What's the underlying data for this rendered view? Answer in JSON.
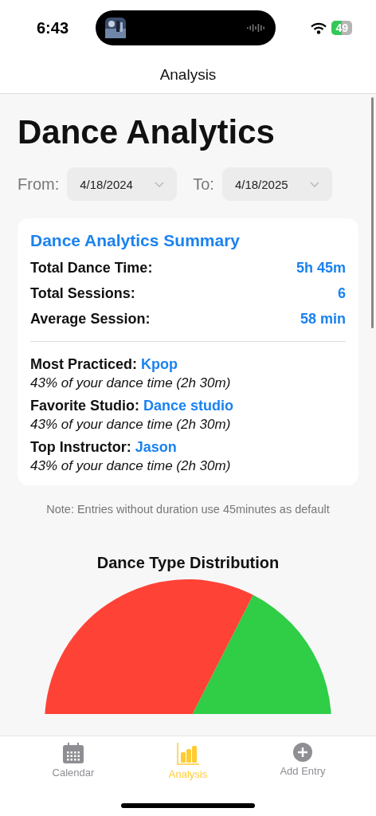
{
  "status_bar": {
    "time": "6:43",
    "battery": "49"
  },
  "nav": {
    "title": "Analysis"
  },
  "heading": "Dance Analytics",
  "range": {
    "from_label": "From:",
    "from": "4/18/2024",
    "to_label": "To:",
    "to": "4/18/2025"
  },
  "summary": {
    "title": "Dance Analytics Summary",
    "stats": [
      {
        "label": "Total Dance Time:",
        "value": "5h 45m"
      },
      {
        "label": "Total Sessions:",
        "value": "6"
      },
      {
        "label": "Average Session:",
        "value": "58 min"
      }
    ],
    "highlights": [
      {
        "label": "Most Practiced:",
        "value": "Kpop",
        "detail": "43% of your dance time (2h 30m)"
      },
      {
        "label": "Favorite Studio:",
        "value": "Dance studio",
        "detail": "43% of your dance time (2h 30m)"
      },
      {
        "label": "Top Instructor:",
        "value": "Jason",
        "detail": "43% of your dance time (2h 30m)"
      }
    ]
  },
  "note": "Note: Entries without duration use 45minutes as default",
  "chart": {
    "title": "Dance Type Distribution"
  },
  "tabs": [
    {
      "kind": "calendar",
      "label": "Calendar",
      "selected": false
    },
    {
      "kind": "analysis",
      "label": "Analysis",
      "selected": true
    },
    {
      "kind": "add",
      "label": "Add Entry",
      "selected": false
    }
  ]
}
